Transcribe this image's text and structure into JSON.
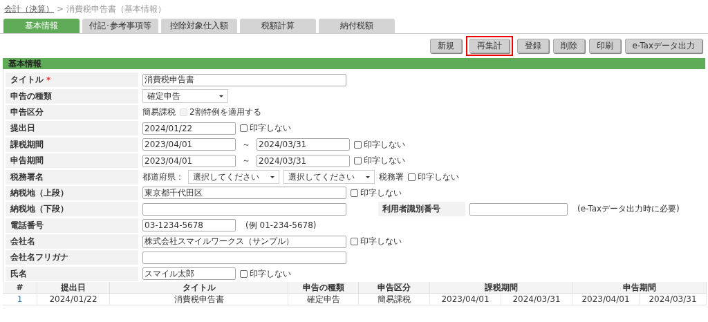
{
  "breadcrumb": {
    "link": "会計（決算）",
    "separator": ">",
    "current": "消費税申告書（基本情報）"
  },
  "tabs": [
    {
      "label": "基本情報",
      "selected": true
    },
    {
      "label": "付記･参考事項等",
      "selected": false
    },
    {
      "label": "控除対象仕入額",
      "selected": false
    },
    {
      "label": "税額計算",
      "selected": false
    },
    {
      "label": "納付税額",
      "selected": false
    }
  ],
  "buttons": [
    {
      "label": "新規",
      "highlighted": false
    },
    {
      "label": "再集計",
      "highlighted": true
    },
    {
      "label": "登録",
      "highlighted": false
    },
    {
      "label": "削除",
      "highlighted": false
    },
    {
      "label": "印刷",
      "highlighted": false
    },
    {
      "label": "e-Taxデータ出力",
      "highlighted": false
    }
  ],
  "section_title": "基本情報",
  "form": [
    {
      "label": "タイトル",
      "required_mark": "*",
      "kind": "text",
      "value": "消費税申告書"
    },
    {
      "label": "申告の種類",
      "kind": "select",
      "value": "確定申告"
    },
    {
      "label": "申告区分",
      "kind": "static",
      "text": "簡易課税",
      "checkbox": {
        "label": "2割特例を適用する",
        "checked": false,
        "disabled": true
      }
    },
    {
      "label": "提出日",
      "kind": "short",
      "value": "2024/01/22",
      "checkbox": {
        "label": "印字しない",
        "checked": false,
        "disabled": false
      }
    },
    {
      "label": "課税期間",
      "kind": "range",
      "from": "2023/04/01",
      "separator": "～",
      "to": "2024/03/31",
      "checkbox": {
        "label": "印字しない",
        "checked": false,
        "disabled": false
      }
    },
    {
      "label": "申告期間",
      "kind": "range",
      "from": "2023/04/01",
      "separator": "～",
      "to": "2024/03/31",
      "checkbox": {
        "label": "印字しない",
        "checked": false,
        "disabled": false
      }
    },
    {
      "label": "税務署名",
      "kind": "office",
      "prefix": "都道府県：",
      "selects": [
        "選択してください",
        "選択してください"
      ],
      "suffix": "税務署",
      "checkbox": {
        "label": "印字しない",
        "checked": false,
        "disabled": false
      }
    },
    {
      "label": "納税地（上段）",
      "kind": "text",
      "value": "東京都千代田区",
      "checkbox": {
        "label": "印字しない",
        "checked": false,
        "disabled": false
      }
    },
    {
      "label": "納税地（下段）",
      "kind": "text",
      "side_label": "利用者識別番号",
      "side_note": "(e-Taxデータ出力時に必要)"
    },
    {
      "label": "電話番号",
      "kind": "short",
      "value": "03-1234-5678",
      "note": "(例  01-234-5678)"
    },
    {
      "label": "会社名",
      "kind": "text",
      "value": "株式会社スマイルワークス（サンプル）",
      "checkbox": {
        "label": "印字しない",
        "checked": false,
        "disabled": false
      }
    },
    {
      "label": "会社名フリガナ",
      "kind": "text"
    },
    {
      "label": "氏名",
      "kind": "short",
      "value": "スマイル太郎",
      "checkbox": {
        "label": "印字しない",
        "checked": false,
        "disabled": false
      }
    }
  ],
  "table": {
    "columns": [
      "#",
      "提出日",
      "タイトル",
      "申告の種類",
      "申告区分",
      "課税期間",
      "申告期間"
    ],
    "rows": [
      [
        "1",
        "2024/01/22",
        "消費税申告書",
        "確定申告",
        "簡易課税",
        [
          "2023/04/01",
          "2024/03/31"
        ],
        [
          "2023/04/01",
          "2024/03/31"
        ]
      ]
    ]
  }
}
